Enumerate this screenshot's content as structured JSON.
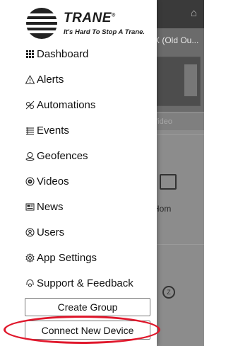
{
  "background": {
    "video_title": "X (Old Ou...",
    "video_button": "Video",
    "card_label": "Hom",
    "card2_icon_text": "Z"
  },
  "drawer": {
    "logo": {
      "word": "TRANE",
      "registered": "®",
      "tagline": "It's Hard To Stop A Trane."
    },
    "menu": [
      {
        "label": "Dashboard",
        "icon": "grid-icon"
      },
      {
        "label": "Alerts",
        "icon": "warning-triangle-icon"
      },
      {
        "label": "Automations",
        "icon": "automation-icon"
      },
      {
        "label": "Events",
        "icon": "list-icon"
      },
      {
        "label": "Geofences",
        "icon": "geofence-icon"
      },
      {
        "label": "Videos",
        "icon": "video-icon"
      },
      {
        "label": "News",
        "icon": "news-icon"
      },
      {
        "label": "Users",
        "icon": "users-icon"
      },
      {
        "label": "App Settings",
        "icon": "gear-icon"
      },
      {
        "label": "Support & Feedback",
        "icon": "support-icon"
      }
    ],
    "create_group_label": "Create Group",
    "connect_device_label": "Connect New Device"
  },
  "colors": {
    "highlight": "#e0182c",
    "text": "#111111"
  }
}
